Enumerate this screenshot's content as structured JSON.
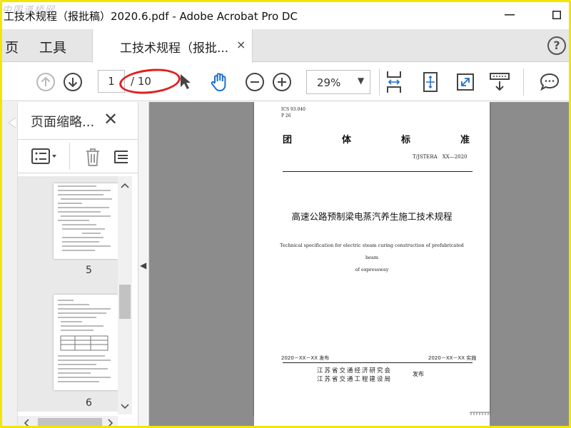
{
  "window": {
    "title": "工技术规程（报批稿）2020.6.pdf - Adobe Acrobat Pro DC",
    "watermark": "中国道桥网"
  },
  "tabs": {
    "home_label": "页",
    "tools_label": "工具",
    "doc_label": "工技术规程（报批...",
    "close_glyph": "×",
    "help_glyph": "?"
  },
  "toolbar": {
    "current_page": "1",
    "total_pages": "/ 10",
    "zoom": "29%",
    "zoom_caret": "▼"
  },
  "sidebar": {
    "title": "页面缩略...",
    "close_glyph": "✕",
    "thumbnails": [
      {
        "page_number": "5"
      },
      {
        "page_number": "6"
      }
    ],
    "collapse_glyph": "◀"
  },
  "document": {
    "ics": "ICS 93.040",
    "p": "P 26",
    "standard_chars": [
      "团",
      "体",
      "标",
      "准"
    ],
    "standard_no": "T/JSTERA　XX—2020",
    "cn_title": "高速公路预制梁电蒸汽养生施工技术规程",
    "en_title_line1": "Technical specification for electric steam curing construction of prefabricated beam",
    "en_title_line2": "of expressway",
    "publish_date": "2020－XX－XX 发布",
    "effective_date": "2020－XX－XX 实施",
    "org1": "江苏省交通经济研究会",
    "org2": "江苏省交通工程建设局",
    "issue_label": "发布"
  },
  "colors": {
    "frame": "#f2e600",
    "annotation_oval": "#e02020",
    "hand_tool": "#1f6fcf",
    "viewer_bg": "#8c8c8c"
  }
}
